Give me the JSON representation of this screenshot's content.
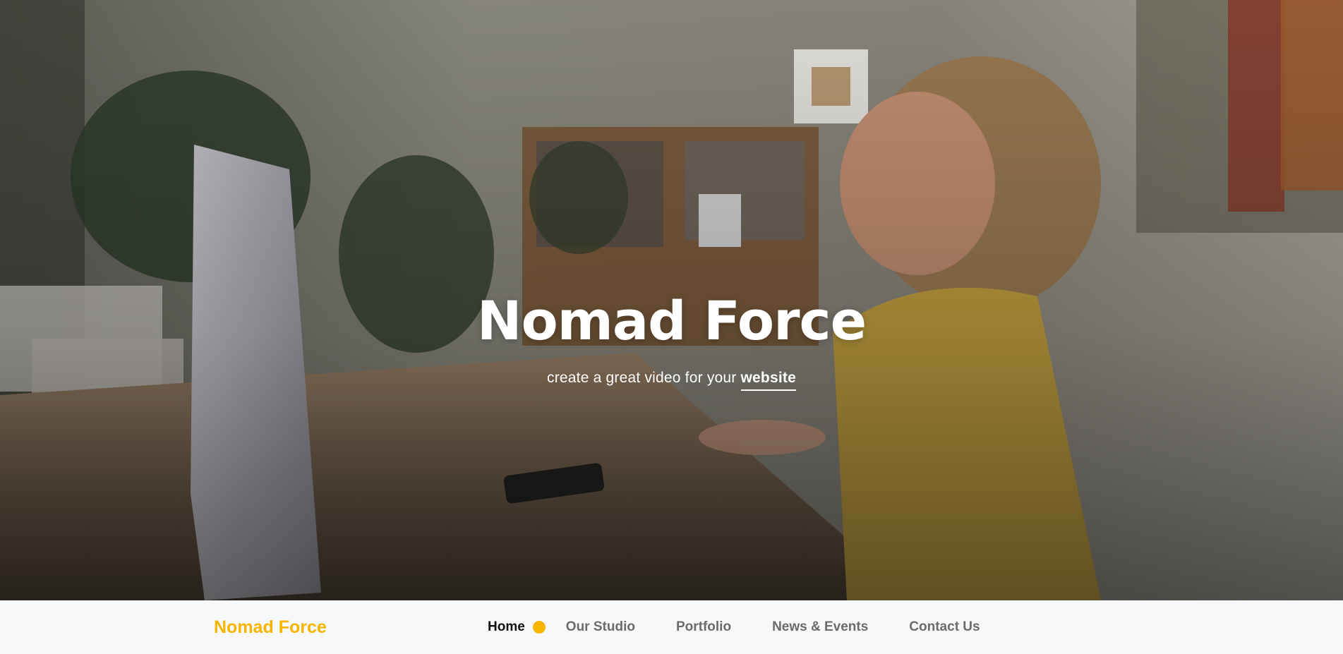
{
  "hero": {
    "title": "Nomad Force",
    "subtitle_prefix": "create a great video for your ",
    "subtitle_emphasis": "website",
    "background_image": "woman-at-desk-photo"
  },
  "navbar": {
    "brand": "Nomad Force",
    "items": [
      {
        "label": "Home",
        "active": true
      },
      {
        "label": "Our Studio",
        "active": false
      },
      {
        "label": "Portfolio",
        "active": false
      },
      {
        "label": "News & Events",
        "active": false
      },
      {
        "label": "Contact Us",
        "active": false
      }
    ]
  },
  "colors": {
    "accent": "#f7b500",
    "nav_text": "#6b6b6b",
    "nav_active": "#111111",
    "nav_background": "#f7f8fa"
  }
}
